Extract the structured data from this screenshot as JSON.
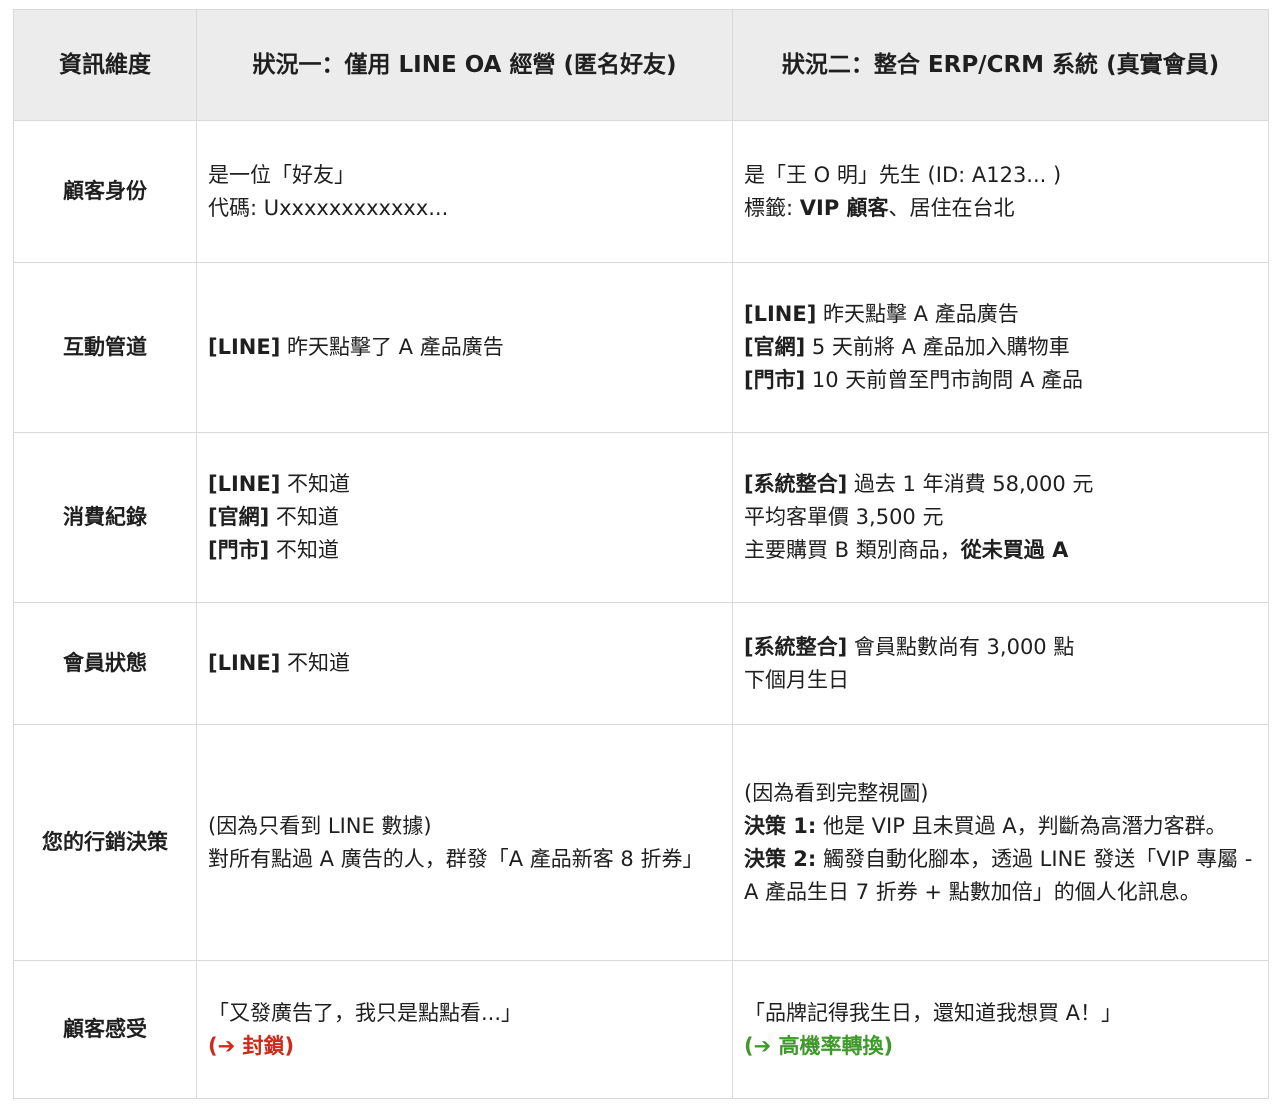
{
  "header": {
    "col1": "資訊維度",
    "col2": "狀況一：僅用 LINE OA 經營 (匿名好友)",
    "col3": "狀況二：整合 ERP/CRM 系統 (真實會員)"
  },
  "rows": [
    {
      "dimension": "顧客身份",
      "case1": {
        "line1": "是一位「好友」",
        "line2": "代碼: Uxxxxxxxxxxxx..."
      },
      "case2": {
        "line1": "是「王 O 明」先生 (ID: A123... )",
        "line2_prefix": "標籤: ",
        "line2_bold": "VIP 顧客",
        "line2_rest": "、居住在台北"
      }
    },
    {
      "dimension": "互動管道",
      "case1": {
        "tag1": "[LINE]",
        "text1": " 昨天點擊了 A 產品廣告"
      },
      "case2": {
        "tag1": "[LINE]",
        "text1": " 昨天點擊 A 產品廣告",
        "tag2": "[官網]",
        "text2": " 5 天前將 A 產品加入購物車",
        "tag3": "[門市]",
        "text3": " 10 天前曾至門市詢問 A 產品"
      }
    },
    {
      "dimension": "消費紀錄",
      "case1": {
        "tag1": "[LINE]",
        "text1": " 不知道",
        "tag2": "[官網]",
        "text2": " 不知道",
        "tag3": "[門市]",
        "text3": " 不知道"
      },
      "case2": {
        "tag1": "[系統整合]",
        "text1": " 過去 1 年消費 58,000 元",
        "line2": "平均客單價 3,500 元",
        "line3_prefix": "主要購買 B 類別商品，",
        "line3_bold": "從未買過 A"
      }
    },
    {
      "dimension": "會員狀態",
      "case1": {
        "tag1": "[LINE]",
        "text1": " 不知道"
      },
      "case2": {
        "tag1": "[系統整合]",
        "text1": " 會員點數尚有 3,000 點",
        "line2": "下個月生日"
      }
    },
    {
      "dimension": "您的行銷決策",
      "case1": {
        "line1": "(因為只看到 LINE 數據)",
        "line2": "對所有點過 A 廣告的人，群發「A 產品新客 8 折券」"
      },
      "case2": {
        "line1": "(因為看到完整視圖)",
        "tag2": "決策 1:",
        "text2": " 他是 VIP 且未買過 A，判斷為高潛力客群。",
        "tag3": "決策 2:",
        "text3": " 觸發自動化腳本，透過 LINE 發送「VIP 專屬 - A 產品生日 7 折券 + 點數加倍」的個人化訊息。"
      }
    },
    {
      "dimension": "顧客感受",
      "case1": {
        "line1": "「又發廣告了，我只是點點看...」",
        "line2": "(➔ 封鎖)"
      },
      "case2": {
        "line1": "「品牌記得我生日，還知道我想買 A！」",
        "line2": "(➔ 高機率轉換)"
      }
    }
  ],
  "colors": {
    "header_bg": "#ececec",
    "border": "#d9d9d9",
    "negative": "#cc2a1a",
    "positive": "#3f9a2b"
  }
}
